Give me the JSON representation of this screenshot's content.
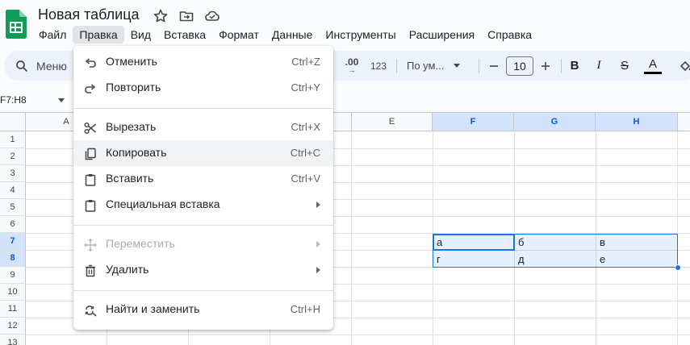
{
  "app": {
    "title": "Новая таблица",
    "icons": [
      "star-icon",
      "move-to-folder-icon",
      "cloud-saved-icon"
    ],
    "colors": {
      "accent": "#1a73e8",
      "logo": "#0f9d58",
      "toolbar_bg": "#edf2fa"
    }
  },
  "menubar": {
    "items": [
      {
        "label": "Файл"
      },
      {
        "label": "Правка",
        "active": true
      },
      {
        "label": "Вид"
      },
      {
        "label": "Вставка"
      },
      {
        "label": "Формат"
      },
      {
        "label": "Данные"
      },
      {
        "label": "Инструменты"
      },
      {
        "label": "Расширения"
      },
      {
        "label": "Справка"
      }
    ]
  },
  "toolbar": {
    "search_label": "Меню",
    "decimal_increase": ".00",
    "decimal_arrow": "→",
    "number_format": "123",
    "font_name": "По ум...",
    "font_size": "10",
    "bold": "B",
    "italic": "I",
    "strike": "S",
    "text_color": "A"
  },
  "namebox": {
    "value": "F7:H8"
  },
  "grid": {
    "columns": [
      {
        "label": "",
        "selected": false
      },
      {
        "label": "A",
        "selected": false
      },
      {
        "label": "",
        "selected": false
      },
      {
        "label": "",
        "selected": false
      },
      {
        "label": "",
        "selected": false
      },
      {
        "label": "E",
        "selected": false
      },
      {
        "label": "F",
        "selected": true
      },
      {
        "label": "G",
        "selected": true
      },
      {
        "label": "H",
        "selected": true
      }
    ],
    "rows": [
      {
        "label": "1",
        "selected": false
      },
      {
        "label": "2",
        "selected": false
      },
      {
        "label": "3",
        "selected": false
      },
      {
        "label": "4",
        "selected": false
      },
      {
        "label": "5",
        "selected": false
      },
      {
        "label": "6",
        "selected": false
      },
      {
        "label": "7",
        "selected": true
      },
      {
        "label": "8",
        "selected": true
      },
      {
        "label": "9",
        "selected": false
      },
      {
        "label": "10",
        "selected": false
      },
      {
        "label": "11",
        "selected": false
      },
      {
        "label": "12",
        "selected": false
      },
      {
        "label": "13",
        "selected": false
      }
    ],
    "cells": {
      "F7": "а",
      "G7": "б",
      "H7": "в",
      "F8": "г",
      "G8": "д",
      "H8": "е"
    }
  },
  "edit_menu": {
    "items": [
      {
        "label": "Отменить",
        "shortcut": "Ctrl+Z",
        "icon": "undo-icon"
      },
      {
        "label": "Повторить",
        "shortcut": "Ctrl+Y",
        "icon": "redo-icon"
      },
      {
        "label": "Вырезать",
        "shortcut": "Ctrl+X",
        "icon": "scissors-icon"
      },
      {
        "label": "Копировать",
        "shortcut": "Ctrl+C",
        "icon": "copy-icon",
        "hover": true
      },
      {
        "label": "Вставить",
        "shortcut": "Ctrl+V",
        "icon": "clipboard-icon"
      },
      {
        "label": "Специальная вставка",
        "submenu": true,
        "icon": "clipboard-special-icon"
      },
      {
        "label": "Переместить",
        "submenu": true,
        "disabled": true,
        "icon": "move-arrows-icon"
      },
      {
        "label": "Удалить",
        "submenu": true,
        "icon": "trash-icon"
      },
      {
        "label": "Найти и заменить",
        "shortcut": "Ctrl+H",
        "icon": "find-replace-icon"
      }
    ]
  }
}
